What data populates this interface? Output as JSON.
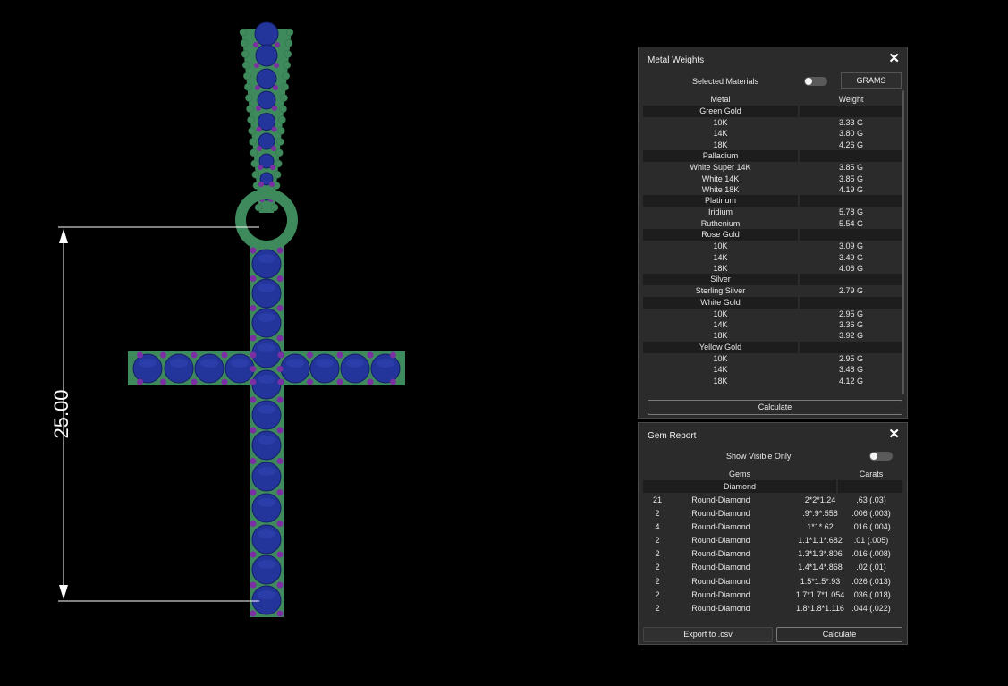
{
  "viewport": {
    "dimension_label": "25.00",
    "colors": {
      "metal": "#3f8a5c",
      "gem": "#23349a",
      "prong": "#7b2fa3",
      "dim_line": "#ffffff"
    }
  },
  "metal_weights": {
    "title": "Metal Weights",
    "close_label": "✕",
    "selected_materials_label": "Selected Materials",
    "units_button": "GRAMS",
    "col_metal": "Metal",
    "col_weight": "Weight",
    "groups": [
      {
        "name": "Green Gold",
        "items": [
          {
            "label": "10K",
            "weight": "3.33 G"
          },
          {
            "label": "14K",
            "weight": "3.80 G"
          },
          {
            "label": "18K",
            "weight": "4.26 G"
          }
        ]
      },
      {
        "name": "Palladium",
        "items": [
          {
            "label": "White Super 14K",
            "weight": "3.85 G"
          },
          {
            "label": "White 14K",
            "weight": "3.85 G"
          },
          {
            "label": "White 18K",
            "weight": "4.19 G"
          }
        ]
      },
      {
        "name": "Platinum",
        "items": [
          {
            "label": "Iridium",
            "weight": "5.78 G"
          },
          {
            "label": "Ruthenium",
            "weight": "5.54 G"
          }
        ]
      },
      {
        "name": "Rose Gold",
        "items": [
          {
            "label": "10K",
            "weight": "3.09 G"
          },
          {
            "label": "14K",
            "weight": "3.49 G"
          },
          {
            "label": "18K",
            "weight": "4.06 G"
          }
        ]
      },
      {
        "name": "Silver",
        "items": [
          {
            "label": "Sterling Silver",
            "weight": "2.79 G"
          }
        ]
      },
      {
        "name": "White Gold",
        "items": [
          {
            "label": "10K",
            "weight": "2.95 G"
          },
          {
            "label": "14K",
            "weight": "3.36 G"
          },
          {
            "label": "18K",
            "weight": "3.92 G"
          }
        ]
      },
      {
        "name": "Yellow Gold",
        "items": [
          {
            "label": "10K",
            "weight": "2.95 G"
          },
          {
            "label": "14K",
            "weight": "3.48 G"
          },
          {
            "label": "18K",
            "weight": "4.12 G"
          }
        ]
      }
    ],
    "calculate_label": "Calculate"
  },
  "gem_report": {
    "title": "Gem Report",
    "close_label": "✕",
    "show_visible_label": "Show Visible Only",
    "col_gems": "Gems",
    "col_carats": "Carats",
    "group_name": "Diamond",
    "rows": [
      {
        "qty": "21",
        "name": "Round-Diamond",
        "size": "2*2*1.24",
        "carats": ".63 (.03)"
      },
      {
        "qty": "2",
        "name": "Round-Diamond",
        "size": ".9*.9*.558",
        "carats": ".006 (.003)"
      },
      {
        "qty": "4",
        "name": "Round-Diamond",
        "size": "1*1*.62",
        "carats": ".016 (.004)"
      },
      {
        "qty": "2",
        "name": "Round-Diamond",
        "size": "1.1*1.1*.682",
        "carats": ".01 (.005)"
      },
      {
        "qty": "2",
        "name": "Round-Diamond",
        "size": "1.3*1.3*.806",
        "carats": ".016 (.008)"
      },
      {
        "qty": "2",
        "name": "Round-Diamond",
        "size": "1.4*1.4*.868",
        "carats": ".02 (.01)"
      },
      {
        "qty": "2",
        "name": "Round-Diamond",
        "size": "1.5*1.5*.93",
        "carats": ".026 (.013)"
      },
      {
        "qty": "2",
        "name": "Round-Diamond",
        "size": "1.7*1.7*1.054",
        "carats": ".036 (.018)"
      },
      {
        "qty": "2",
        "name": "Round-Diamond",
        "size": "1.8*1.8*1.116",
        "carats": ".044 (.022)"
      }
    ],
    "export_label": "Export to .csv",
    "calculate_label": "Calculate"
  }
}
